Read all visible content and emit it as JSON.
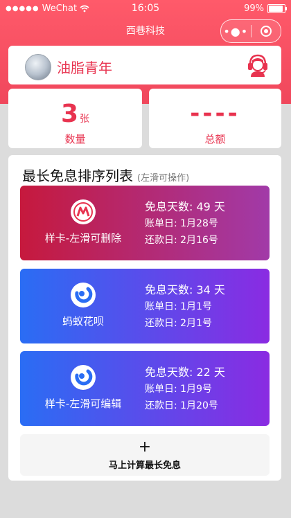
{
  "status_bar": {
    "carrier": "WeChat",
    "time": "16:05",
    "battery": "99%"
  },
  "nav": {
    "title": "西巷科技",
    "more_icon": "more-icon",
    "close_icon": "close-icon"
  },
  "user": {
    "name": "油脂青年",
    "service_icon": "customer-service-icon"
  },
  "stats": {
    "count": {
      "value": "3",
      "unit": "张",
      "label": "数量"
    },
    "total": {
      "value": "----",
      "label": "总额"
    }
  },
  "list": {
    "title": "最长免息排序列表",
    "hint": "(左滑可操作)",
    "cards": [
      {
        "name": "样卡-左滑可删除",
        "logo": "bank-logo-icon",
        "free_days": "免息天数:  49 天",
        "bill_day": "账单日:  1月28号",
        "repay_day": "还款日:  2月16号",
        "gradient": [
          "#c6193d",
          "#a13aa8"
        ]
      },
      {
        "name": "蚂蚁花呗",
        "logo": "huabei-icon",
        "free_days": "免息天数:  34 天",
        "bill_day": "账单日:  1月1号",
        "repay_day": "还款日:  2月1号",
        "gradient": [
          "#2a6df4",
          "#8a2be2"
        ]
      },
      {
        "name": "样卡-左滑可编辑",
        "logo": "huabei-icon",
        "free_days": "免息天数:  22 天",
        "bill_day": "账单日:  1月9号",
        "repay_day": "还款日:  1月20号",
        "gradient": [
          "#2a6df4",
          "#8a2be2"
        ]
      }
    ]
  },
  "calc": {
    "plus": "+",
    "label": "马上计算最长免息"
  }
}
